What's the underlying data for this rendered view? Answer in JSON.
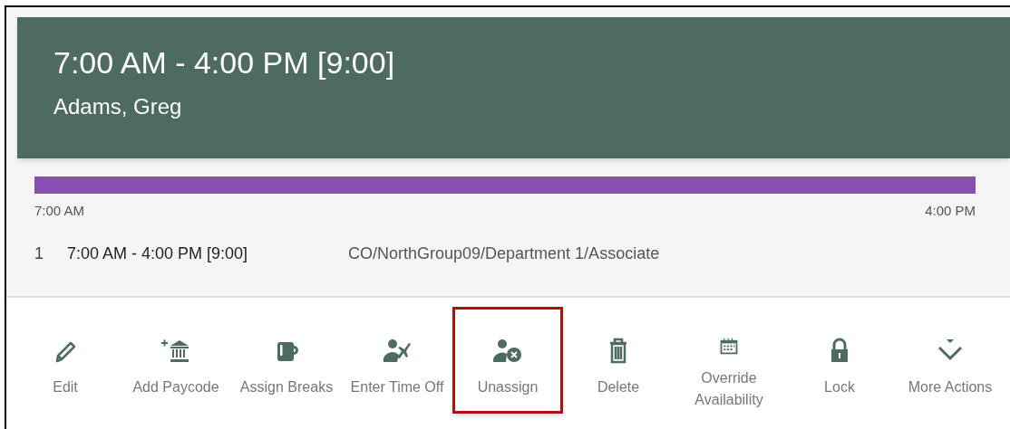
{
  "header": {
    "title": "7:00 AM - 4:00 PM [9:00]",
    "employee": "Adams, Greg"
  },
  "timeline": {
    "start": "7:00 AM",
    "end": "4:00 PM"
  },
  "segments": [
    {
      "number": "1",
      "time": "7:00 AM - 4:00 PM [9:00]",
      "path": "CO/NorthGroup09/Department 1/Associate"
    }
  ],
  "actions": [
    {
      "kind": "edit",
      "label": "Edit",
      "highlighted": false
    },
    {
      "kind": "paycode",
      "label": "Add Paycode",
      "highlighted": false
    },
    {
      "kind": "breaks",
      "label": "Assign Breaks",
      "highlighted": false
    },
    {
      "kind": "timeoff",
      "label": "Enter Time Off",
      "highlighted": false
    },
    {
      "kind": "unassign",
      "label": "Unassign",
      "highlighted": true
    },
    {
      "kind": "delete",
      "label": "Delete",
      "highlighted": false
    },
    {
      "kind": "override",
      "label": "Override Availability",
      "highlighted": false
    },
    {
      "kind": "lock",
      "label": "Lock",
      "highlighted": false
    },
    {
      "kind": "more",
      "label": "More Actions",
      "highlighted": false
    }
  ]
}
